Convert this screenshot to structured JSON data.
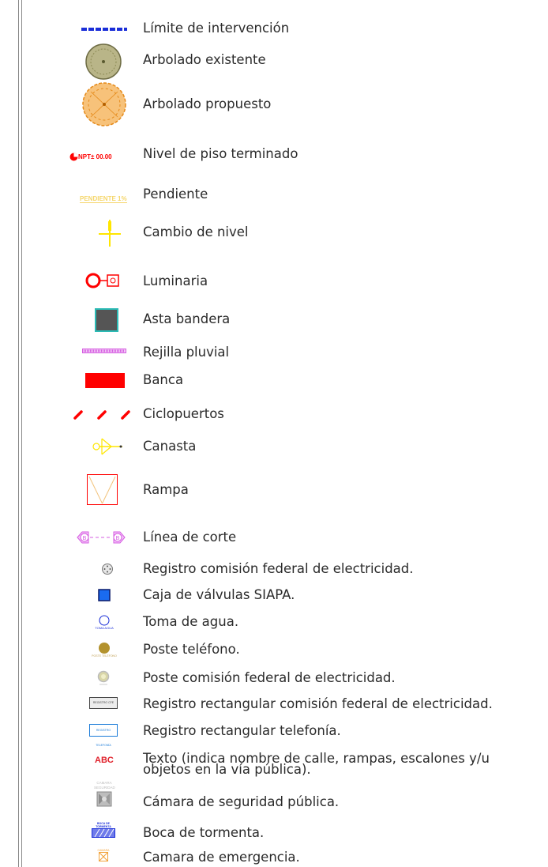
{
  "legend": {
    "items": [
      {
        "label": "Límite de intervención",
        "icon": "boundary-line-icon"
      },
      {
        "label": "Arbolado existente",
        "icon": "existing-tree-icon"
      },
      {
        "label": "Arbolado propuesto",
        "icon": "proposed-tree-icon"
      },
      {
        "label": "Nivel de piso terminado",
        "icon": "floor-level-icon",
        "symbol_text": "NPT± 00.00"
      },
      {
        "label": "Pendiente",
        "icon": "slope-icon",
        "symbol_text": "PENDIENTE 1%"
      },
      {
        "label": "Cambio de nivel",
        "icon": "level-change-icon"
      },
      {
        "label": "Luminaria",
        "icon": "luminaire-icon"
      },
      {
        "label": "Asta bandera",
        "icon": "flagpole-icon"
      },
      {
        "label": "Rejilla pluvial",
        "icon": "storm-grate-icon"
      },
      {
        "label": "Banca",
        "icon": "bench-icon"
      },
      {
        "label": "Ciclopuertos",
        "icon": "bike-rack-icon"
      },
      {
        "label": "Canasta",
        "icon": "basket-icon"
      },
      {
        "label": "Rampa",
        "icon": "ramp-icon"
      },
      {
        "label": "Línea de corte",
        "icon": "section-line-icon",
        "symbol_text": "B"
      },
      {
        "label": "Registro comisión federal de electricidad.",
        "icon": "cfe-register-icon"
      },
      {
        "label": "Caja de válvulas SIAPA.",
        "icon": "valve-box-icon"
      },
      {
        "label": "Toma de agua.",
        "icon": "water-intake-icon",
        "symbol_text": "TOMA AGUA"
      },
      {
        "label": "Poste teléfono.",
        "icon": "phone-pole-icon",
        "symbol_text": "POSTE TELÉFONO"
      },
      {
        "label": "Poste comisión federal de electricidad.",
        "icon": "cfe-pole-icon"
      },
      {
        "label": "Registro rectangular comisión federal de electricidad.",
        "icon": "cfe-rect-register-icon",
        "symbol_text": "REGISTRO CFE"
      },
      {
        "label": "Registro rectangular telefonía.",
        "icon": "phone-rect-register-icon",
        "symbol_text": "REGISTRO TELEFONÍA"
      },
      {
        "label": "Texto (indica nombre de calle, rampas, escalones y/u",
        "label2": "objetos en la vía pública).",
        "icon": "text-icon",
        "symbol_text": "ABC"
      },
      {
        "label": "Cámara de seguridad pública.",
        "icon": "security-camera-icon",
        "symbol_text": "CAMARA SEGURIDAD"
      },
      {
        "label": "Boca de tormenta.",
        "icon": "storm-drain-icon",
        "symbol_text": "BOCA DE TORMENTA"
      },
      {
        "label": "Camara de emergencia.",
        "icon": "emergency-camera-icon",
        "symbol_text": "CAMARA"
      }
    ]
  },
  "colors": {
    "red": "#ff0000",
    "blue": "#1a2ed8",
    "orange": "#f2a33a",
    "olive": "#8c8a55",
    "yellow": "#ffe600",
    "magenta": "#d45ce0",
    "teal": "#2bbbb5"
  }
}
